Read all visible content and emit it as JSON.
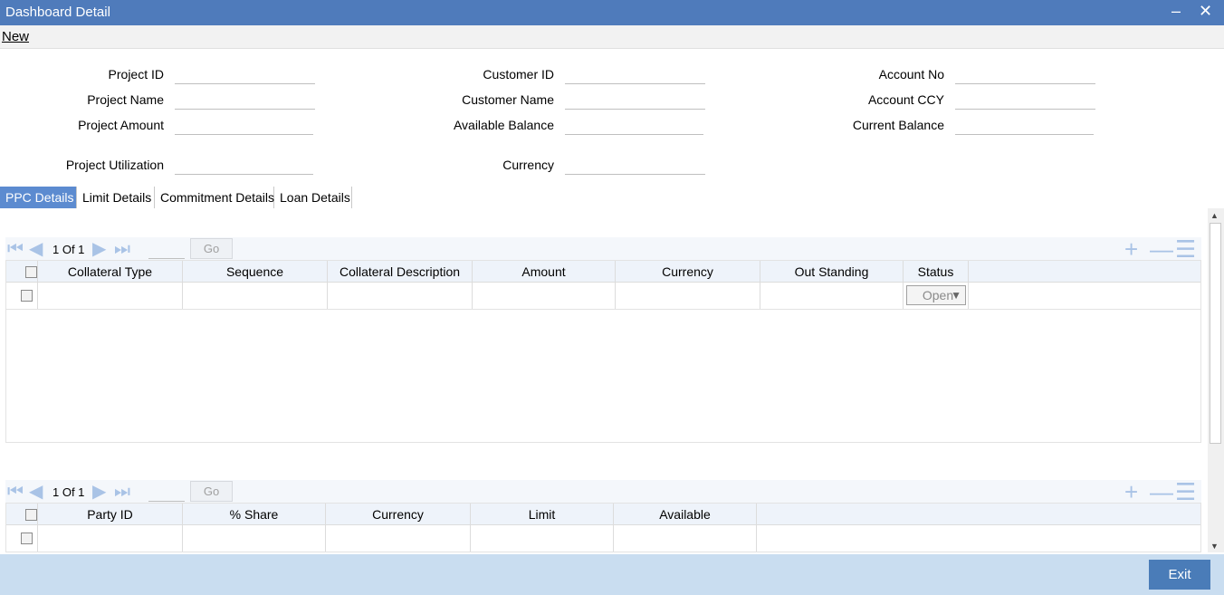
{
  "window": {
    "title": "Dashboard Detail",
    "minimize": "–",
    "close": "✕"
  },
  "menu": {
    "new_label": "New"
  },
  "form": {
    "project_id": "Project ID",
    "project_name": "Project Name",
    "project_amount": "Project Amount",
    "project_utilization": "Project Utilization",
    "customer_id": "Customer ID",
    "customer_name": "Customer Name",
    "available_balance": "Available Balance",
    "currency": "Currency",
    "account_no": "Account No",
    "account_ccy": "Account CCY",
    "current_balance": "Current Balance"
  },
  "tabs": [
    "PPC Details",
    "Limit Details",
    "Commitment Details",
    "Loan Details"
  ],
  "pager1": {
    "text": "1 Of 1",
    "go": "Go"
  },
  "grid1": {
    "columns": [
      "Collateral Type",
      "Sequence",
      "Collateral Description",
      "Amount",
      "Currency",
      "Out Standing",
      "Status"
    ],
    "row_status": "Open"
  },
  "pager2": {
    "text": "1 Of 1",
    "go": "Go"
  },
  "grid2": {
    "columns": [
      "Party ID",
      "% Share",
      "Currency",
      "Limit",
      "Available"
    ]
  },
  "footer": {
    "exit_label": "Exit"
  }
}
